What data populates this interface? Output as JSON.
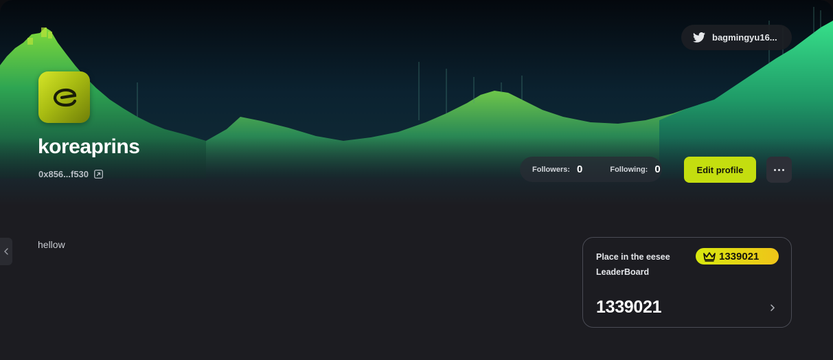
{
  "profile": {
    "username": "koreaprins",
    "address": "0x856...f530",
    "bio": "hellow",
    "avatar_icon": "eesee-logo-icon"
  },
  "social": {
    "twitter_handle": "bagmingyu16...",
    "twitter_icon": "twitter-icon"
  },
  "stats": {
    "followers_label": "Followers:",
    "followers_value": "0",
    "following_label": "Following:",
    "following_value": "0"
  },
  "actions": {
    "edit_label": "Edit profile",
    "more_icon": "more-icon"
  },
  "leaderboard": {
    "title": "Place in the eesee LeaderBoard",
    "badge_value": "1339021",
    "value": "1339021",
    "badge_icon": "crown-icon",
    "arrow_icon": "chevron-right-icon"
  },
  "colors": {
    "accent": "#c4de0f",
    "background": "#1c1c21",
    "banner_green": "#2fb35a"
  }
}
